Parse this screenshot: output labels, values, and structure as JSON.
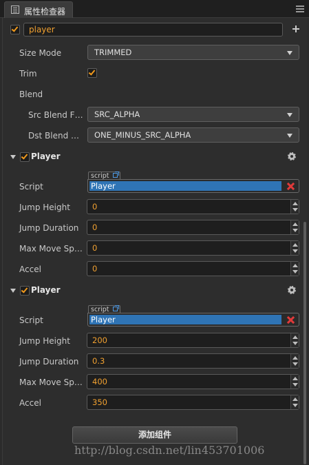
{
  "window": {
    "tab_title": "属性检查器"
  },
  "node": {
    "enabled": true,
    "name": "player"
  },
  "sprite": {
    "size_mode": {
      "label": "Size Mode",
      "value": "TRIMMED"
    },
    "trim": {
      "label": "Trim",
      "checked": true
    },
    "blend": {
      "label": "Blend"
    },
    "src_blend": {
      "label": "Src Blend F…",
      "value": "SRC_ALPHA"
    },
    "dst_blend": {
      "label": "Dst Blend …",
      "value": "ONE_MINUS_SRC_ALPHA"
    }
  },
  "components": [
    {
      "title": "Player",
      "enabled": true,
      "script_tag": "script",
      "script_label": "Script",
      "script_value": "Player",
      "fields": [
        {
          "label": "Jump Height",
          "value": "0"
        },
        {
          "label": "Jump Duration",
          "value": "0"
        },
        {
          "label": "Max Move Sp…",
          "value": "0"
        },
        {
          "label": "Accel",
          "value": "0"
        }
      ]
    },
    {
      "title": "Player",
      "enabled": true,
      "script_tag": "script",
      "script_label": "Script",
      "script_value": "Player",
      "fields": [
        {
          "label": "Jump Height",
          "value": "200"
        },
        {
          "label": "Jump Duration",
          "value": "0.3"
        },
        {
          "label": "Max Move Sp…",
          "value": "400"
        },
        {
          "label": "Accel",
          "value": "350"
        }
      ]
    }
  ],
  "add_component_label": "添加组件",
  "watermark": "http://blog.csdn.net/lin453701006",
  "colors": {
    "accent": "#f29a1c",
    "script_highlight": "#2f74b5",
    "remove": "#e03a3a"
  }
}
